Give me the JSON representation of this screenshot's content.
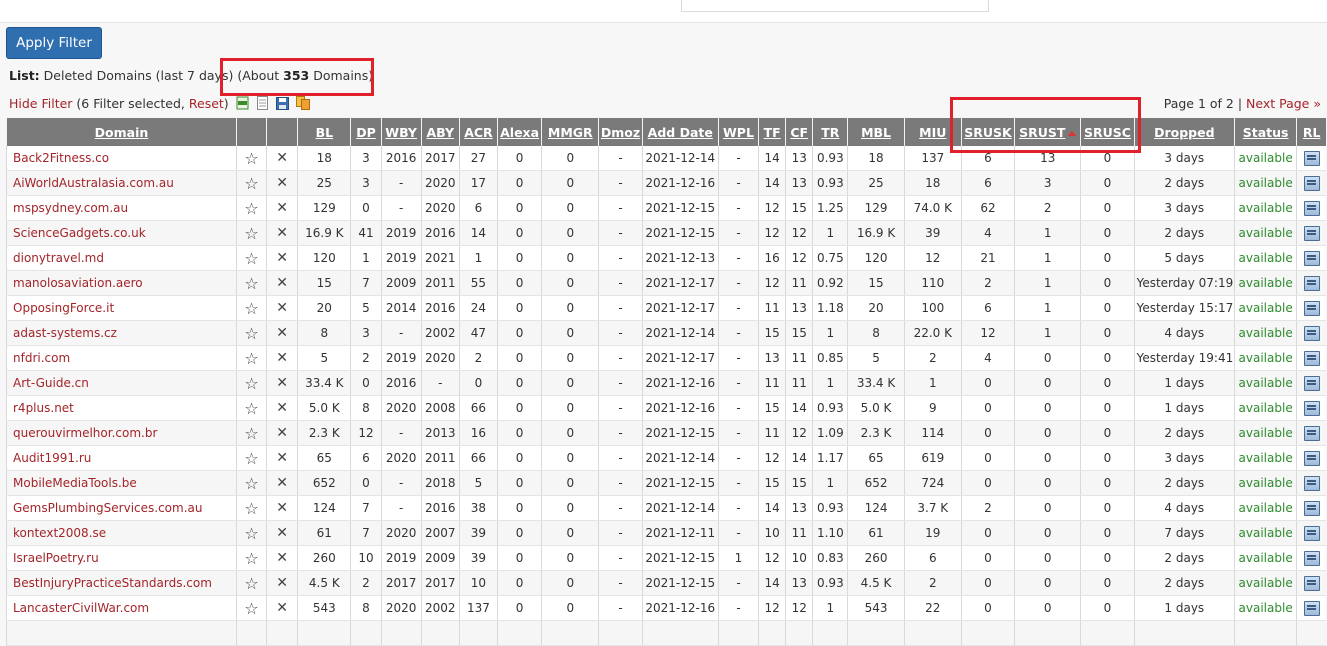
{
  "filter": {
    "apply_label": "Apply Filter",
    "list_label": "List:",
    "list_desc": "Deleted Domains (last 7 days)",
    "about_pre": "(About ",
    "about_count": "353",
    "about_post": " Domains)",
    "hide_filter": "Hide Filter",
    "selected_pre": "(6 Filter selected, ",
    "reset": "Reset",
    "selected_post": ")"
  },
  "paging": {
    "page_info": "Page 1 of 2 | ",
    "next_label": "Next Page »"
  },
  "columns": [
    "Domain",
    "",
    "",
    "BL",
    "DP",
    "WBY",
    "ABY",
    "ACR",
    "Alexa",
    "MMGR",
    "Dmoz",
    "Add Date",
    "WPL",
    "TF",
    "CF",
    "TR",
    "MBL",
    "MIU",
    "SRUSK",
    "SRUST",
    "SRUSC",
    "Dropped",
    "Status",
    "RL"
  ],
  "sorted_column": "SRUST",
  "colors": {
    "accent": "#2f6fb0",
    "link": "#a3252a",
    "available": "#2e8b2e",
    "highlight": "#e0202a",
    "header_bg": "#7a7a7a"
  },
  "icons": {
    "star": "star-icon",
    "delete": "close-icon",
    "rl": "report-icon"
  },
  "rows": [
    [
      "Back2Fitness.co",
      "18",
      "3",
      "2016",
      "2017",
      "27",
      "0",
      "0",
      "-",
      "2021-12-14",
      "-",
      "14",
      "13",
      "0.93",
      "18",
      "137",
      "6",
      "13",
      "0",
      "3 days",
      "available"
    ],
    [
      "AiWorldAustralasia.com.au",
      "25",
      "3",
      "-",
      "2020",
      "17",
      "0",
      "0",
      "-",
      "2021-12-16",
      "-",
      "14",
      "13",
      "0.93",
      "25",
      "18",
      "6",
      "3",
      "0",
      "2 days",
      "available"
    ],
    [
      "mspsydney.com.au",
      "129",
      "0",
      "-",
      "2020",
      "6",
      "0",
      "0",
      "-",
      "2021-12-15",
      "-",
      "12",
      "15",
      "1.25",
      "129",
      "74.0 K",
      "62",
      "2",
      "0",
      "3 days",
      "available"
    ],
    [
      "ScienceGadgets.co.uk",
      "16.9 K",
      "41",
      "2019",
      "2016",
      "14",
      "0",
      "0",
      "-",
      "2021-12-15",
      "-",
      "12",
      "12",
      "1",
      "16.9 K",
      "39",
      "4",
      "1",
      "0",
      "2 days",
      "available"
    ],
    [
      "dionytravel.md",
      "120",
      "1",
      "2019",
      "2021",
      "1",
      "0",
      "0",
      "-",
      "2021-12-13",
      "-",
      "16",
      "12",
      "0.75",
      "120",
      "12",
      "21",
      "1",
      "0",
      "5 days",
      "available"
    ],
    [
      "manolosaviation.aero",
      "15",
      "7",
      "2009",
      "2011",
      "55",
      "0",
      "0",
      "-",
      "2021-12-17",
      "-",
      "12",
      "11",
      "0.92",
      "15",
      "110",
      "2",
      "1",
      "0",
      "Yesterday 07:19",
      "available"
    ],
    [
      "OpposingForce.it",
      "20",
      "5",
      "2014",
      "2016",
      "24",
      "0",
      "0",
      "-",
      "2021-12-17",
      "-",
      "11",
      "13",
      "1.18",
      "20",
      "100",
      "6",
      "1",
      "0",
      "Yesterday 15:17",
      "available"
    ],
    [
      "adast-systems.cz",
      "8",
      "3",
      "-",
      "2002",
      "47",
      "0",
      "0",
      "-",
      "2021-12-14",
      "-",
      "15",
      "15",
      "1",
      "8",
      "22.0 K",
      "12",
      "1",
      "0",
      "4 days",
      "available"
    ],
    [
      "nfdri.com",
      "5",
      "2",
      "2019",
      "2020",
      "2",
      "0",
      "0",
      "-",
      "2021-12-17",
      "-",
      "13",
      "11",
      "0.85",
      "5",
      "2",
      "4",
      "0",
      "0",
      "Yesterday 19:41",
      "available"
    ],
    [
      "Art-Guide.cn",
      "33.4 K",
      "0",
      "2016",
      "-",
      "0",
      "0",
      "0",
      "-",
      "2021-12-16",
      "-",
      "11",
      "11",
      "1",
      "33.4 K",
      "1",
      "0",
      "0",
      "0",
      "1 days",
      "available"
    ],
    [
      "r4plus.net",
      "5.0 K",
      "8",
      "2020",
      "2008",
      "66",
      "0",
      "0",
      "-",
      "2021-12-16",
      "-",
      "15",
      "14",
      "0.93",
      "5.0 K",
      "9",
      "0",
      "0",
      "0",
      "1 days",
      "available"
    ],
    [
      "querouvirmelhor.com.br",
      "2.3 K",
      "12",
      "-",
      "2013",
      "16",
      "0",
      "0",
      "-",
      "2021-12-15",
      "-",
      "11",
      "12",
      "1.09",
      "2.3 K",
      "114",
      "0",
      "0",
      "0",
      "2 days",
      "available"
    ],
    [
      "Audit1991.ru",
      "65",
      "6",
      "2020",
      "2011",
      "66",
      "0",
      "0",
      "-",
      "2021-12-14",
      "-",
      "12",
      "14",
      "1.17",
      "65",
      "619",
      "0",
      "0",
      "0",
      "3 days",
      "available"
    ],
    [
      "MobileMediaTools.be",
      "652",
      "0",
      "-",
      "2018",
      "5",
      "0",
      "0",
      "-",
      "2021-12-15",
      "-",
      "15",
      "15",
      "1",
      "652",
      "724",
      "0",
      "0",
      "0",
      "2 days",
      "available"
    ],
    [
      "GemsPlumbingServices.com.au",
      "124",
      "7",
      "-",
      "2016",
      "38",
      "0",
      "0",
      "-",
      "2021-12-14",
      "-",
      "14",
      "13",
      "0.93",
      "124",
      "3.7 K",
      "2",
      "0",
      "0",
      "4 days",
      "available"
    ],
    [
      "kontext2008.se",
      "61",
      "7",
      "2020",
      "2007",
      "39",
      "0",
      "0",
      "-",
      "2021-12-11",
      "-",
      "10",
      "11",
      "1.10",
      "61",
      "19",
      "0",
      "0",
      "0",
      "7 days",
      "available"
    ],
    [
      "IsraelPoetry.ru",
      "260",
      "10",
      "2019",
      "2009",
      "39",
      "0",
      "0",
      "-",
      "2021-12-15",
      "1",
      "12",
      "10",
      "0.83",
      "260",
      "6",
      "0",
      "0",
      "0",
      "2 days",
      "available"
    ],
    [
      "BestInjuryPracticeStandards.com",
      "4.5 K",
      "2",
      "2017",
      "2017",
      "10",
      "0",
      "0",
      "-",
      "2021-12-15",
      "-",
      "14",
      "13",
      "0.93",
      "4.5 K",
      "2",
      "0",
      "0",
      "0",
      "2 days",
      "available"
    ],
    [
      "LancasterCivilWar.com",
      "543",
      "8",
      "2020",
      "2002",
      "137",
      "0",
      "0",
      "-",
      "2021-12-16",
      "-",
      "12",
      "12",
      "1",
      "543",
      "22",
      "0",
      "0",
      "0",
      "1 days",
      "available"
    ],
    [
      "",
      "",
      "",
      "",
      "",
      "",
      "",
      "",
      "",
      "",
      "",
      "",
      "",
      "",
      "",
      "",
      "",
      "",
      "",
      "",
      ""
    ]
  ]
}
